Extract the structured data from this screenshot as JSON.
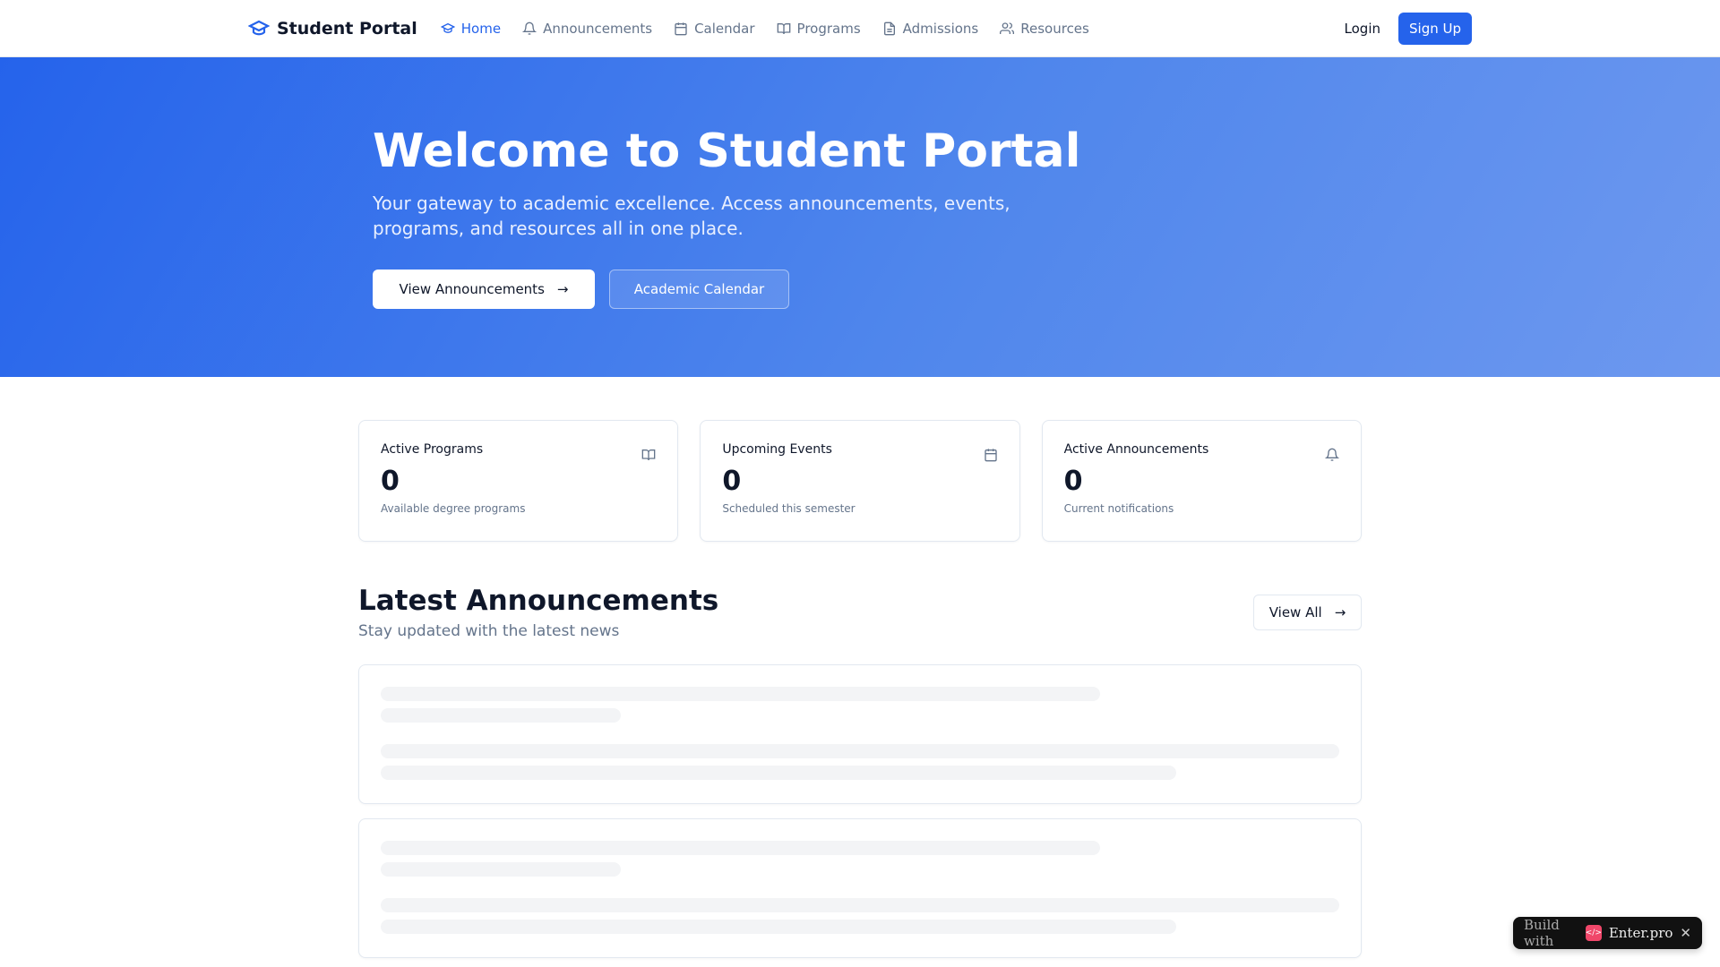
{
  "nav": {
    "brand": "Student Portal",
    "links": [
      {
        "label": "Home"
      },
      {
        "label": "Announcements"
      },
      {
        "label": "Calendar"
      },
      {
        "label": "Programs"
      },
      {
        "label": "Admissions"
      },
      {
        "label": "Resources"
      }
    ],
    "login": "Login",
    "signup": "Sign Up"
  },
  "hero": {
    "title": "Welcome to Student Portal",
    "subtitle": "Your gateway to academic excellence. Access announcements, events, programs, and resources all in one place.",
    "primary": "View Announcements",
    "secondary": "Academic Calendar"
  },
  "stats": [
    {
      "title": "Active Programs",
      "value": "0",
      "sub": "Available degree programs"
    },
    {
      "title": "Upcoming Events",
      "value": "0",
      "sub": "Scheduled this semester"
    },
    {
      "title": "Active Announcements",
      "value": "0",
      "sub": "Current notifications"
    }
  ],
  "latest": {
    "title": "Latest Announcements",
    "subtitle": "Stay updated with the latest news",
    "view_all": "View All"
  },
  "badge": {
    "prefix": "Build with",
    "brand": "Enter.pro",
    "logo": "</>",
    "close": "✕"
  }
}
